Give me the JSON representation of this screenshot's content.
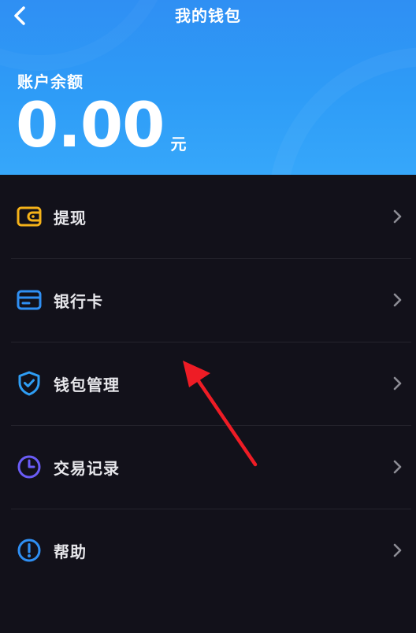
{
  "header": {
    "title": "我的钱包",
    "balance_label": "账户余额",
    "balance_amount": "0.00",
    "balance_unit": "元"
  },
  "menu": {
    "items": [
      {
        "label": "提现",
        "icon": "wallet-icon",
        "color": "#f5b219"
      },
      {
        "label": "银行卡",
        "icon": "credit-card-icon",
        "color": "#2f8ff3"
      },
      {
        "label": "钱包管理",
        "icon": "shield-check-icon",
        "color": "#2f9ef5"
      },
      {
        "label": "交易记录",
        "icon": "clock-icon",
        "color": "#6a5cf6"
      },
      {
        "label": "帮助",
        "icon": "info-circle-icon",
        "color": "#2f8ff3"
      }
    ]
  },
  "colors": {
    "header_gradient_top": "#2f8ff3",
    "header_gradient_bottom": "#36a7fa",
    "background": "#12111a",
    "annotation_arrow": "#ee1c25"
  }
}
